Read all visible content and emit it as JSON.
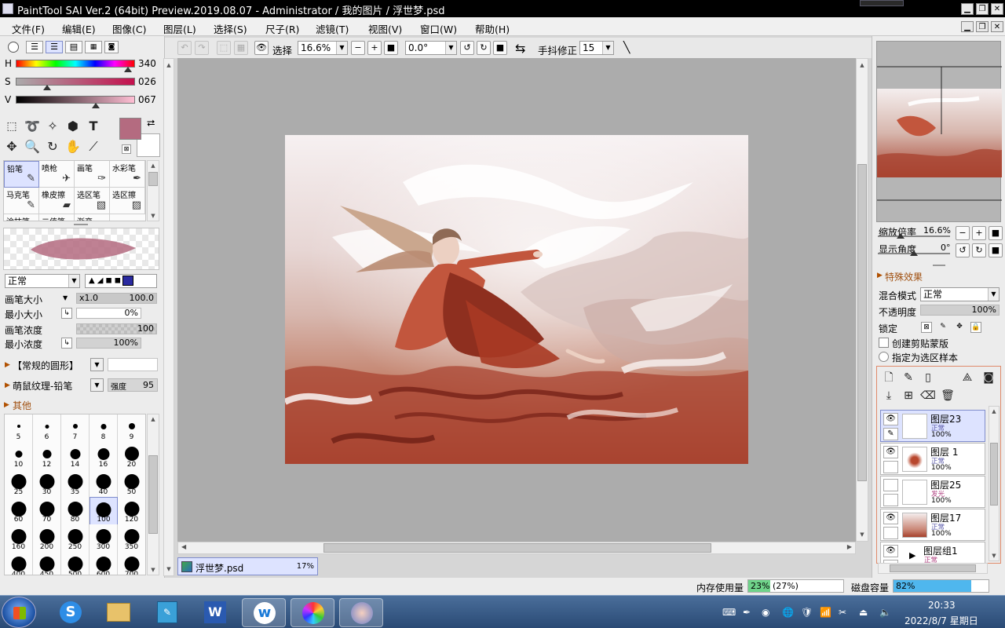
{
  "window": {
    "title": "PaintTool SAI Ver.2 (64bit) Preview.2019.08.07 - Administrator / 我的图片 / 浮世梦.psd"
  },
  "menu": [
    "文件(F)",
    "编辑(E)",
    "图像(C)",
    "图层(L)",
    "选择(S)",
    "尺子(R)",
    "滤镜(T)",
    "视图(V)",
    "窗口(W)",
    "帮助(H)"
  ],
  "toolbar": {
    "select_label": "选择",
    "zoom_value": "16.6%",
    "rotation_value": "0.0°",
    "stabilizer_label": "手抖修正",
    "stabilizer_value": "15"
  },
  "color": {
    "h_label": "H",
    "h_value": "340",
    "h_fraction": 0.944,
    "s_label": "S",
    "s_value": "026",
    "s_fraction": 0.26,
    "v_label": "V",
    "v_value": "067",
    "v_fraction": 0.67,
    "primary": "#b46b80",
    "secondary": "#ffffff"
  },
  "brushes": [
    {
      "label": "铅笔",
      "icon": "✎",
      "selected": true
    },
    {
      "label": "喷枪",
      "icon": "✈",
      "selected": false
    },
    {
      "label": "画笔",
      "icon": "✑",
      "selected": false
    },
    {
      "label": "水彩笔",
      "icon": "✒",
      "selected": false
    },
    {
      "label": "马克笔",
      "icon": "✎",
      "selected": false
    },
    {
      "label": "橡皮擦",
      "icon": "▰",
      "selected": false
    },
    {
      "label": "选区笔",
      "icon": "▧",
      "selected": false
    },
    {
      "label": "选区擦",
      "icon": "▨",
      "selected": false
    },
    {
      "label": "涂抹笔",
      "icon": "",
      "selected": false
    },
    {
      "label": "二值笔",
      "icon": "",
      "selected": false
    },
    {
      "label": "渐变",
      "icon": "",
      "selected": false
    }
  ],
  "brush_settings": {
    "blend_mode": "正常",
    "size_label": "画笔大小",
    "size_multiplier": "x1.0",
    "size_value": "100.0",
    "min_size_label": "最小大小",
    "min_size_value": "0%",
    "density_label": "画笔浓度",
    "density_value": "100",
    "min_density_label": "最小浓度",
    "min_density_value": "100%",
    "shape_label": "【常规的圆形】",
    "texture_label": "萌鼠纹理-铅笔",
    "strength_label": "强度",
    "strength_value": "95",
    "other_label": "其他"
  },
  "brush_sizes": [
    {
      "v": "5",
      "d": 4
    },
    {
      "v": "6",
      "d": 5
    },
    {
      "v": "7",
      "d": 6
    },
    {
      "v": "8",
      "d": 7
    },
    {
      "v": "9",
      "d": 8
    },
    {
      "v": "10",
      "d": 9
    },
    {
      "v": "12",
      "d": 11
    },
    {
      "v": "14",
      "d": 13
    },
    {
      "v": "16",
      "d": 15
    },
    {
      "v": "20",
      "d": 18
    },
    {
      "v": "25",
      "d": 19
    },
    {
      "v": "30",
      "d": 19
    },
    {
      "v": "35",
      "d": 19
    },
    {
      "v": "40",
      "d": 19
    },
    {
      "v": "50",
      "d": 19
    },
    {
      "v": "60",
      "d": 19
    },
    {
      "v": "70",
      "d": 19
    },
    {
      "v": "80",
      "d": 19
    },
    {
      "v": "100",
      "d": 19,
      "sel": true
    },
    {
      "v": "120",
      "d": 19
    },
    {
      "v": "160",
      "d": 19
    },
    {
      "v": "200",
      "d": 19
    },
    {
      "v": "250",
      "d": 19
    },
    {
      "v": "300",
      "d": 19
    },
    {
      "v": "350",
      "d": 19
    },
    {
      "v": "400",
      "d": 19
    },
    {
      "v": "450",
      "d": 19
    },
    {
      "v": "500",
      "d": 19
    },
    {
      "v": "600",
      "d": 19
    },
    {
      "v": "700",
      "d": 19
    }
  ],
  "document_tab": {
    "name": "浮世梦.psd",
    "zoom": "17%"
  },
  "navigator": {
    "zoom_label": "缩放倍率",
    "zoom_value": "16.6%",
    "angle_label": "显示角度",
    "angle_value": "0°"
  },
  "layer_props": {
    "effects_label": "特殊效果",
    "blend_label": "混合模式",
    "blend_value": "正常",
    "opacity_label": "不透明度",
    "opacity_value": "100%",
    "lock_label": "锁定",
    "clip_label": "创建剪贴蒙版",
    "sample_label": "指定为选区样本"
  },
  "layers": [
    {
      "name": "图层23",
      "mode": "正常",
      "opacity": "100%",
      "visible": true,
      "selected": true
    },
    {
      "name": "图层 1",
      "mode": "正常",
      "opacity": "100%",
      "visible": true,
      "selected": false
    },
    {
      "name": "图层25",
      "mode": "发光",
      "opacity": "100%",
      "visible": false,
      "selected": false
    },
    {
      "name": "图层17",
      "mode": "正常",
      "opacity": "100%",
      "visible": true,
      "selected": false
    },
    {
      "name": "图层组1",
      "mode": "正常",
      "opacity": "",
      "visible": true,
      "selected": false
    }
  ],
  "status": {
    "memory_label": "内存使用量",
    "memory_value": "23% (27%)",
    "memory_fraction": 0.23,
    "disk_label": "磁盘容量",
    "disk_value": "82%",
    "disk_fraction": 0.82
  },
  "taskbar": {
    "time": "20:33",
    "date": "2022/8/7 星期日"
  },
  "colors": {
    "accent": "#7f8ccc",
    "selection_bg": "#dde3ff",
    "canvas_bg": "#acacac",
    "memory_bar": "#6fd38a",
    "disk_bar": "#4fb7ee"
  }
}
